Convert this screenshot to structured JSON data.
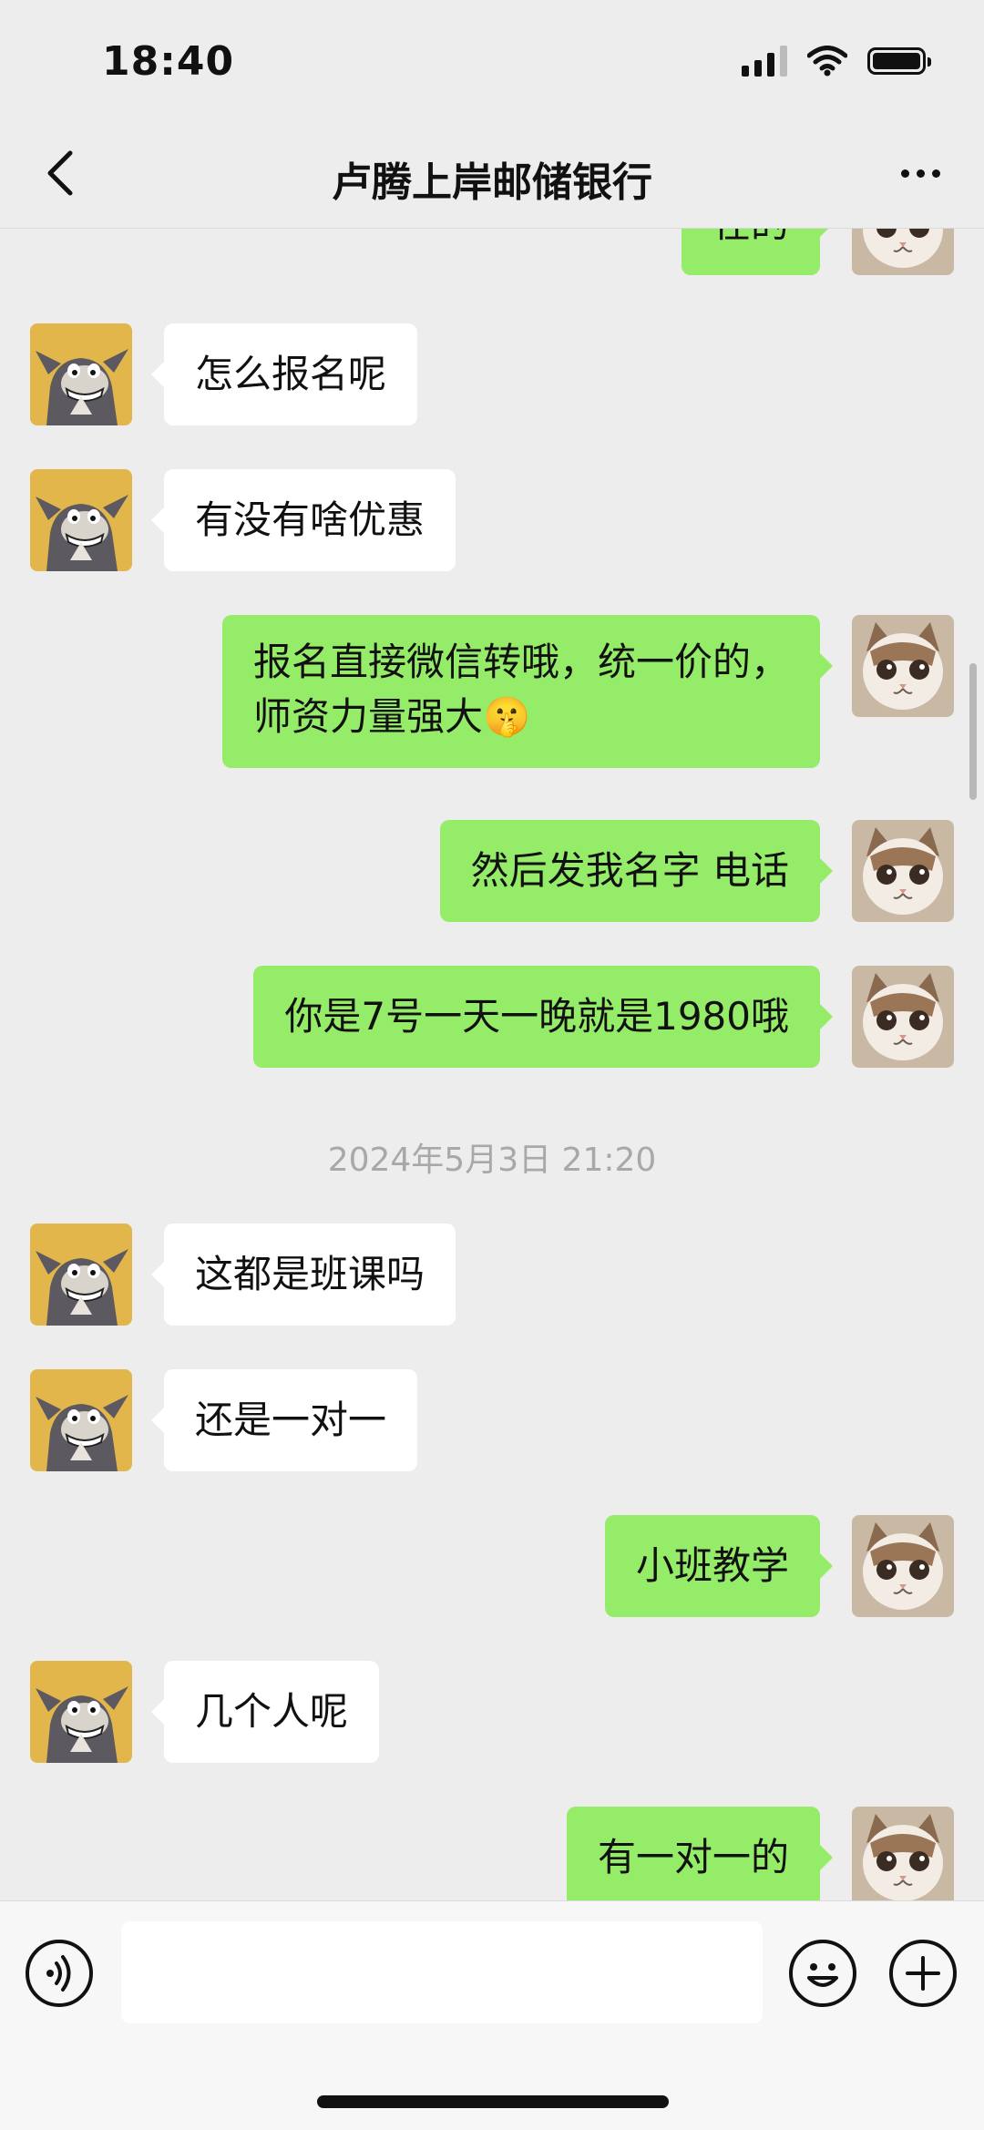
{
  "status_bar": {
    "time": "18:40"
  },
  "nav": {
    "title": "卢腾上岸邮储银行"
  },
  "messages": [
    {
      "side": "out",
      "text": "在的"
    },
    {
      "side": "in",
      "text": "怎么报名呢"
    },
    {
      "side": "in",
      "text": "有没有啥优惠"
    },
    {
      "side": "out",
      "text": "报名直接微信转哦，统一价的，\n师资力量强大🤫"
    },
    {
      "side": "out",
      "text": "然后发我名字 电话"
    },
    {
      "side": "out",
      "text": "你是7号一天一晚就是1980哦"
    },
    {
      "side": "in",
      "text": "这都是班课吗"
    },
    {
      "side": "in",
      "text": "还是一对一"
    },
    {
      "side": "out",
      "text": "小班教学"
    },
    {
      "side": "in",
      "text": "几个人呢"
    },
    {
      "side": "out",
      "text": "有一对一的"
    }
  ],
  "timestamp": "2024年5月3日 21:20",
  "input": {
    "placeholder": ""
  },
  "icons": {
    "back": "chevron-left-icon",
    "more": "more-dots-icon",
    "voice": "voice-icon",
    "emoji": "emoji-icon",
    "plus": "plus-icon",
    "contact_avatar": "tom-cat-avatar",
    "self_avatar": "kitten-avatar"
  },
  "colors": {
    "background": "#ededed",
    "outgoing_bubble": "#95ec69",
    "incoming_bubble": "#ffffff",
    "timestamp_text": "#a8a8a8"
  }
}
